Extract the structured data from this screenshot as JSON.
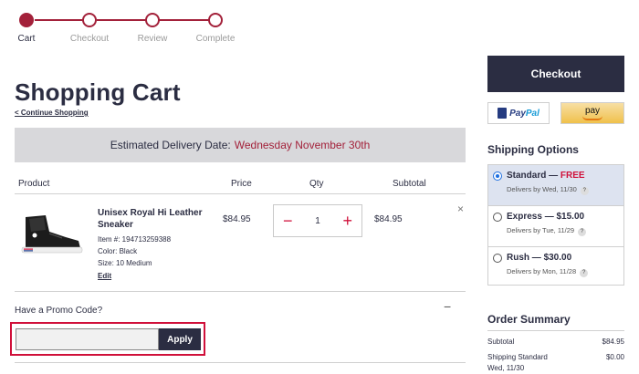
{
  "steps": [
    {
      "label": "Cart",
      "active": true
    },
    {
      "label": "Checkout",
      "active": false
    },
    {
      "label": "Review",
      "active": false
    },
    {
      "label": "Complete",
      "active": false
    }
  ],
  "page_title": "Shopping Cart",
  "continue_link": "< Continue Shopping",
  "delivery": {
    "label": "Estimated Delivery Date:",
    "date": "Wednesday November 30th"
  },
  "table_headers": {
    "product": "Product",
    "price": "Price",
    "qty": "Qty",
    "subtotal": "Subtotal"
  },
  "item": {
    "name": "Unisex Royal Hi Leather Sneaker",
    "item_number": "Item #: 194713259388",
    "color": "Color: Black",
    "size": "Size: 10 Medium",
    "edit": "Edit",
    "price": "$84.95",
    "qty": "1",
    "subtotal": "$84.95",
    "minus": "−",
    "plus": "+",
    "remove": "×"
  },
  "promo": {
    "title": "Have a Promo Code?",
    "toggle": "−",
    "placeholder": "",
    "apply": "Apply"
  },
  "checkout": "Checkout",
  "paypal": {
    "p1": "Pay",
    "p2": "Pal"
  },
  "amazon": "pay",
  "shipping": {
    "title": "Shipping Options",
    "options": [
      {
        "name": "Standard — ",
        "price": "FREE",
        "delivers": "Delivers by Wed, 11/30",
        "selected": true
      },
      {
        "name": "Express — ",
        "price": "$15.00",
        "delivers": "Delivers by Tue, 11/29",
        "selected": false
      },
      {
        "name": "Rush — ",
        "price": "$30.00",
        "delivers": "Delivers by Mon, 11/28",
        "selected": false
      }
    ],
    "help": "?"
  },
  "order_summary": {
    "title": "Order Summary",
    "rows": [
      {
        "label": "Subtotal",
        "value": "$84.95"
      },
      {
        "label": "Shipping Standard",
        "value": "$0.00"
      },
      {
        "label": "Wed, 11/30",
        "value": ""
      }
    ]
  },
  "colors": {
    "accent": "#a3213a",
    "navy": "#2b2d42",
    "highlight": "#d0103a"
  }
}
